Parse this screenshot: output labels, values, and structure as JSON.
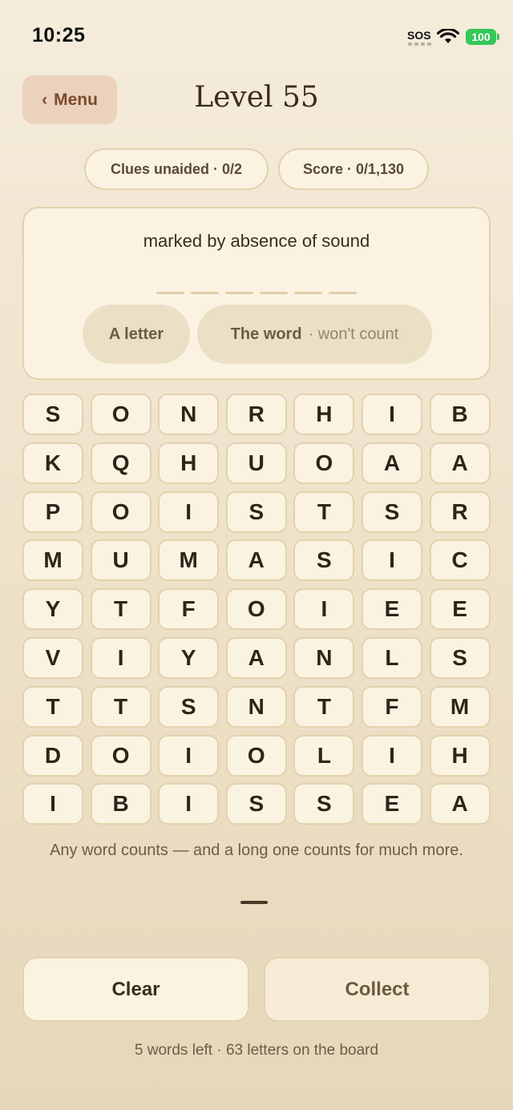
{
  "status": {
    "time": "10:25",
    "sos": "SOS",
    "battery": "100",
    "battery_color": "#34c759"
  },
  "header": {
    "back_chevron": "‹",
    "menu_label": "Menu",
    "title": "Level 55"
  },
  "pills": {
    "clues": "Clues unaided · 0/2",
    "score": "Score · 0/1,130"
  },
  "clue": {
    "text": "marked by absence of sound",
    "blank_count": 6,
    "hint_letter_label": "A letter",
    "hint_word_label": "The word",
    "hint_word_sub": "· won't count"
  },
  "grid": [
    [
      "S",
      "O",
      "N",
      "R",
      "H",
      "I",
      "B"
    ],
    [
      "K",
      "Q",
      "H",
      "U",
      "O",
      "A",
      "A"
    ],
    [
      "P",
      "O",
      "I",
      "S",
      "T",
      "S",
      "R"
    ],
    [
      "M",
      "U",
      "M",
      "A",
      "S",
      "I",
      "C"
    ],
    [
      "Y",
      "T",
      "F",
      "O",
      "I",
      "E",
      "E"
    ],
    [
      "V",
      "I",
      "Y",
      "A",
      "N",
      "L",
      "S"
    ],
    [
      "T",
      "T",
      "S",
      "N",
      "T",
      "F",
      "M"
    ],
    [
      "D",
      "O",
      "I",
      "O",
      "L",
      "I",
      "H"
    ],
    [
      "I",
      "B",
      "I",
      "S",
      "S",
      "E",
      "A"
    ]
  ],
  "hint_line": "Any word counts — and a long one counts for much more.",
  "buttons": {
    "clear": "Clear",
    "collect": "Collect"
  },
  "footer": "5 words left · 63 letters on the board",
  "colors": {
    "background": "#f0e6d0",
    "tile": "#fbf3e2",
    "tile_border": "#e3d2ad",
    "menu_bg": "#ecd2bc",
    "text": "#3a2c1d"
  }
}
